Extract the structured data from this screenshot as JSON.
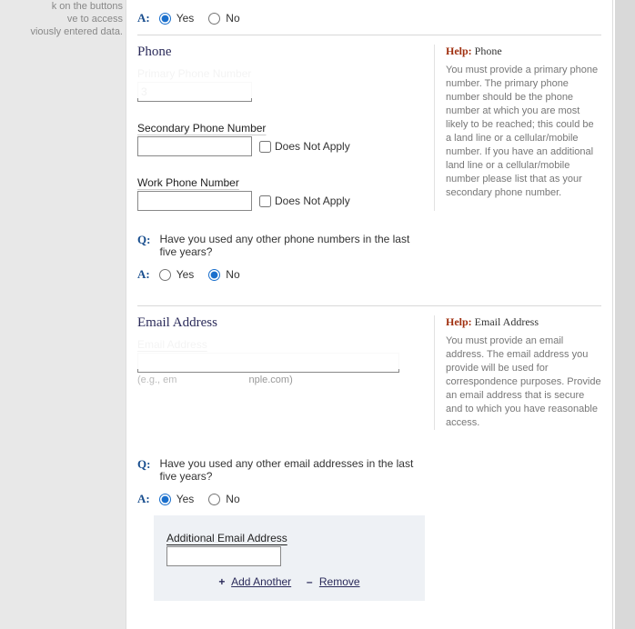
{
  "leftNote": {
    "line1": "k on the buttons",
    "line2": "ve to access",
    "line3": "viously entered data."
  },
  "qa_top": {
    "a_prefix": "A:",
    "yes": "Yes",
    "no": "No"
  },
  "phone": {
    "title": "Phone",
    "help_prefix": "Help:",
    "help_subject": "Phone",
    "help_body": "You must provide a primary phone number. The primary phone number should be the phone number at which you are most likely to be reached; this could be a land line or a cellular/mobile number. If you have an additional land line or a cellular/mobile number please list that as your secondary phone number.",
    "primary_label": "Primary Phone Number",
    "primary_value": "3",
    "secondary_label": "Secondary Phone Number",
    "work_label": "Work Phone Number",
    "dna": "Does Not Apply",
    "q_prefix": "Q:",
    "q_text": "Have you used any other phone numbers in the last five years?",
    "a_prefix": "A:",
    "yes": "Yes",
    "no": "No"
  },
  "email": {
    "title": "Email Address",
    "help_prefix": "Help:",
    "help_subject": "Email Address",
    "help_body": "You must provide an email address.  The email address you provide will be used for correspondence purposes.  Provide an email address that is secure and to which you have reasonable access.",
    "field_label": "Email Address",
    "value": "",
    "hint": "(e.g., emailaddress@example.com)",
    "hint_masked": "nple.com)",
    "q_prefix": "Q:",
    "q_text": "Have you used any other email addresses in the last five years?",
    "a_prefix": "A:",
    "yes": "Yes",
    "no": "No",
    "additional": {
      "label": "Additional Email Address",
      "add": "Add Another",
      "remove": "Remove"
    }
  }
}
